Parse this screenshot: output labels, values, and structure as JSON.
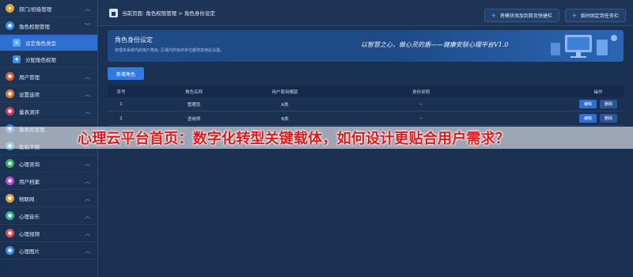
{
  "topbar": {
    "breadcrumb": "当前页面: 角色权限管理 > 角色身份设定",
    "btn_quick": "将模块添加到首页快捷栏",
    "btn_pin": "临时固定到任务栏"
  },
  "sidebar": {
    "items": [
      {
        "label": "部门/班级管理",
        "icon": "org-icon",
        "color": "#e0a33a"
      },
      {
        "label": "角色权限管理",
        "icon": "role-icon",
        "color": "#3a8fe0"
      },
      {
        "label": "设定角色类型",
        "icon": "gear-icon",
        "color": "#3a8fe0"
      },
      {
        "label": "分配角色权限",
        "icon": "puzzle-icon",
        "color": "#3a8fe0"
      },
      {
        "label": "用户管理",
        "icon": "user-icon",
        "color": "#e05a3a"
      },
      {
        "label": "设置选项",
        "icon": "settings-icon",
        "color": "#e07a2a"
      },
      {
        "label": "量表测评",
        "icon": "test-icon",
        "color": "#d23b5a"
      },
      {
        "label": "量表库管理",
        "icon": "library-icon",
        "color": "#3a7fe0"
      },
      {
        "label": "危机干预",
        "icon": "crisis-icon",
        "color": "#2aa0c0"
      },
      {
        "label": "心理咨询",
        "icon": "consult-icon",
        "color": "#3ab06a"
      },
      {
        "label": "用户档案",
        "icon": "archive-icon",
        "color": "#c04ad0"
      },
      {
        "label": "物联网",
        "icon": "iot-icon",
        "color": "#e0a33a"
      },
      {
        "label": "心理音乐",
        "icon": "music-icon",
        "color": "#3ab0a0"
      },
      {
        "label": "心理视频",
        "icon": "video-icon",
        "color": "#e05050"
      },
      {
        "label": "心理图片",
        "icon": "image-icon",
        "color": "#3a8fe0"
      }
    ]
  },
  "banner": {
    "title": "角色身份设定",
    "desc": "管理本系统内的用户角色, 区域内所有的单位都将复用此设置。",
    "slogan": "以智慧之心，做心灵的盾——健康安联心理平台V1.0"
  },
  "add_button": "新增角色",
  "table": {
    "headers": [
      "序号",
      "角色名称",
      "用户套用模版",
      "身份说明",
      "操作"
    ],
    "rows": [
      {
        "idx": "1",
        "name": "管理员",
        "tpl": "A类",
        "desc": "--"
      },
      {
        "idx": "2",
        "name": "咨询师",
        "tpl": "B类",
        "desc": "--"
      }
    ],
    "edit_label": "编辑",
    "delete_label": "删除"
  },
  "overlay_title": "心理云平台首页：数字化转型关键载体，如何设计更贴合用户需求？"
}
